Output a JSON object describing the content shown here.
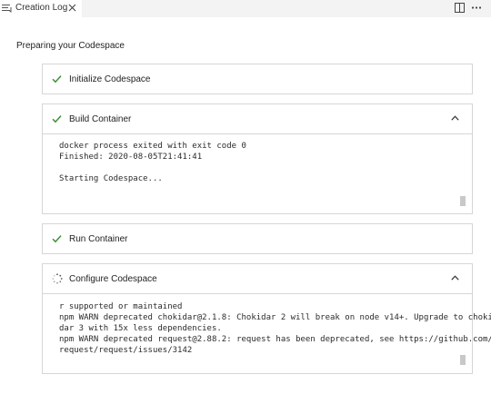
{
  "tab": {
    "label": "Creation Log"
  },
  "heading": "Preparing your Codespace",
  "steps": [
    {
      "title": "Initialize Codespace",
      "status": "done"
    },
    {
      "title": "Build Container",
      "status": "done",
      "log": "docker process exited with exit code 0\nFinished: 2020-08-05T21:41:41\n\nStarting Codespace..."
    },
    {
      "title": "Run Container",
      "status": "done"
    },
    {
      "title": "Configure Codespace",
      "status": "in-progress",
      "log": "r supported or maintained\nnpm WARN deprecated chokidar@2.1.8: Chokidar 2 will break on node v14+. Upgrade to choki\ndar 3 with 15x less dependencies.\nnpm WARN deprecated request@2.88.2: request has been deprecated, see https://github.com/\nrequest/request/issues/3142"
    }
  ],
  "colors": {
    "check": "#388a34",
    "border": "#d6d6d6"
  },
  "icons": {
    "tab": "output-icon",
    "tab_close": "close-icon",
    "split": "split-editor-icon",
    "more": "more-actions-icon",
    "done": "check-icon",
    "in_progress": "spinner-icon",
    "expanded": "chevron-up-icon"
  }
}
